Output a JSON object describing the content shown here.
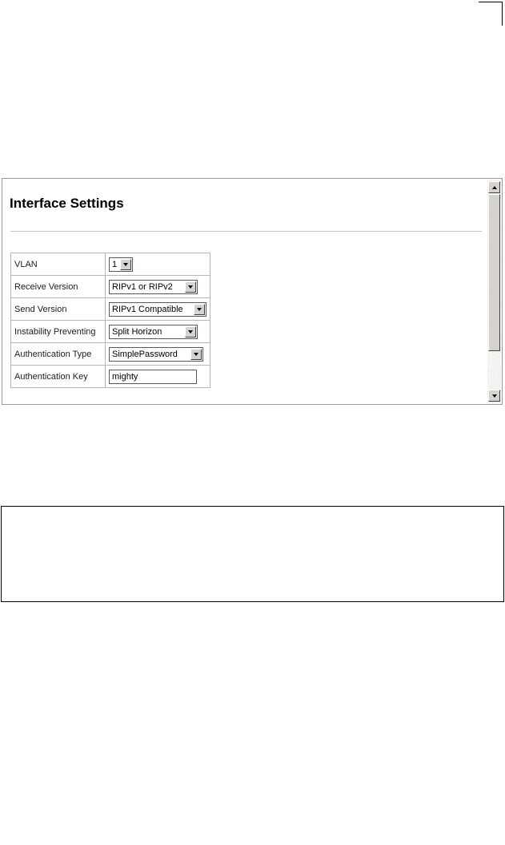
{
  "panel": {
    "title": "Interface Settings"
  },
  "form": {
    "rows": [
      {
        "label": "VLAN",
        "type": "select",
        "value": "1"
      },
      {
        "label": "Receive Version",
        "type": "select",
        "value": "RIPv1 or RIPv2"
      },
      {
        "label": "Send Version",
        "type": "select",
        "value": "RIPv1 Compatible"
      },
      {
        "label": "Instability Preventing",
        "type": "select",
        "value": "Split Horizon"
      },
      {
        "label": "Authentication Type",
        "type": "select",
        "value": "SimplePassword"
      },
      {
        "label": "Authentication Key",
        "type": "input",
        "value": "mighty"
      }
    ]
  },
  "icons": {
    "dropdown": "chevron-down-icon",
    "scroll_up": "arrow-up-icon",
    "scroll_down": "arrow-down-icon"
  },
  "colors": {
    "border": "#b7b7b7",
    "control_face": "#d6d3ce"
  }
}
